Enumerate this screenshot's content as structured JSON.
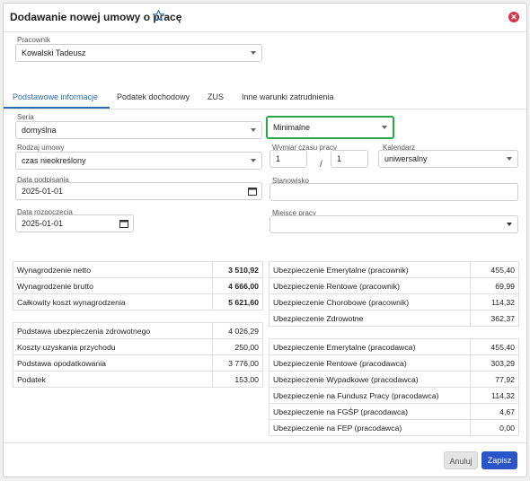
{
  "dialog": {
    "title": "Dodawanie nowej umowy o pracę",
    "star_icon": "star-icon",
    "close_icon": "close-icon"
  },
  "employee": {
    "label": "Pracownik",
    "value": "Kowalski Tadeusz"
  },
  "tabs": [
    {
      "label": "Podstawowe informacje",
      "active": true
    },
    {
      "label": "Podatek dochodowy",
      "active": false
    },
    {
      "label": "ZUS",
      "active": false
    },
    {
      "label": "Inne warunki zatrudnienia",
      "active": false
    }
  ],
  "form": {
    "series": {
      "label": "Seria",
      "value": "domyślna"
    },
    "salary_option": {
      "value": "Minimalne"
    },
    "contract_type": {
      "label": "Rodzaj umowy",
      "value": "czas nieokreślony"
    },
    "working_time": {
      "label": "Wymiar czasu pracy",
      "numerator": "1",
      "separator": "/",
      "denominator": "1"
    },
    "calendar": {
      "label": "Kalendarz",
      "value": "uniwersalny"
    },
    "signed_date": {
      "label": "Data podpisania",
      "value": "2025-01-01"
    },
    "position": {
      "label": "Stanowisko",
      "value": ""
    },
    "start_date": {
      "label": "Data rozpoczęcia",
      "value": "2025-01-01"
    },
    "workplace": {
      "label": "Miejsce pracy",
      "value": ""
    }
  },
  "summary_left_1": [
    {
      "label": "Wynagrodzenie netto",
      "value": "3 510,92"
    },
    {
      "label": "Wynagrodzenie brutto",
      "value": "4 666,00"
    },
    {
      "label": "Całkowity koszt wynagrodzenia",
      "value": "5 621,60"
    }
  ],
  "summary_left_2": [
    {
      "label": "Podstawa ubezpieczenia zdrowotnego",
      "value": "4 026,29"
    },
    {
      "label": "Koszty uzyskania przychodu",
      "value": "250,00"
    },
    {
      "label": "Podstawa opodatkowania",
      "value": "3 776,00"
    },
    {
      "label": "Podatek",
      "value": "153,00"
    }
  ],
  "summary_right_1": [
    {
      "label": "Ubezpieczenie Emerytalne (pracownik)",
      "value": "455,40"
    },
    {
      "label": "Ubezpieczenie Rentowe (pracownik)",
      "value": "69,99"
    },
    {
      "label": "Ubezpieczenie Chorobowe (pracownik)",
      "value": "114,32"
    },
    {
      "label": "Ubezpieczenie Zdrowotne",
      "value": "362,37"
    }
  ],
  "summary_right_2": [
    {
      "label": "Ubezpieczenie Emerytalne (pracodawca)",
      "value": "455,40"
    },
    {
      "label": "Ubezpieczenie Rentowe (pracodawca)",
      "value": "303,29"
    },
    {
      "label": "Ubezpieczenie Wypadkowe (pracodawca)",
      "value": "77,92"
    },
    {
      "label": "Ubezpieczenie na Fundusz Pracy (pracodawca)",
      "value": "114,32"
    },
    {
      "label": "Ubezpieczenie na FGŚP (pracodawca)",
      "value": "4,67"
    },
    {
      "label": "Ubezpieczenie na FEP (pracodawca)",
      "value": "0,00"
    }
  ],
  "footer": {
    "cancel_label": "Anuluj",
    "save_label": "Zapisz"
  },
  "colors": {
    "accent": "#2b6cb0",
    "highlight": "#27a745",
    "close": "#d9334b",
    "save": "#2a55c9"
  }
}
